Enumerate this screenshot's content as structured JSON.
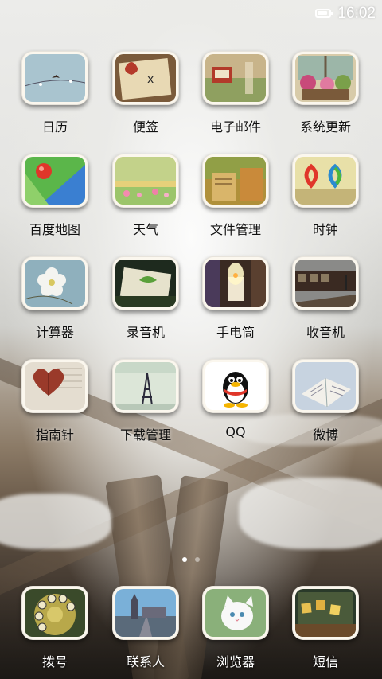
{
  "status_bar": {
    "time": "16:02",
    "battery_level": 0.85
  },
  "apps": [
    {
      "label": "日历",
      "icon": "calendar-icon"
    },
    {
      "label": "便签",
      "icon": "notes-icon"
    },
    {
      "label": "电子邮件",
      "icon": "mail-icon"
    },
    {
      "label": "系统更新",
      "icon": "system-update-icon"
    },
    {
      "label": "百度地图",
      "icon": "baidu-map-icon"
    },
    {
      "label": "天气",
      "icon": "weather-icon"
    },
    {
      "label": "文件管理",
      "icon": "file-manager-icon"
    },
    {
      "label": "时钟",
      "icon": "clock-icon"
    },
    {
      "label": "计算器",
      "icon": "calculator-icon"
    },
    {
      "label": "录音机",
      "icon": "recorder-icon"
    },
    {
      "label": "手电筒",
      "icon": "flashlight-icon"
    },
    {
      "label": "收音机",
      "icon": "radio-icon"
    },
    {
      "label": "指南针",
      "icon": "compass-icon"
    },
    {
      "label": "下载管理",
      "icon": "download-manager-icon"
    },
    {
      "label": "QQ",
      "icon": "qq-icon"
    },
    {
      "label": "微博",
      "icon": "weibo-icon"
    }
  ],
  "dock": [
    {
      "label": "拨号",
      "icon": "dialer-icon"
    },
    {
      "label": "联系人",
      "icon": "contacts-icon"
    },
    {
      "label": "浏览器",
      "icon": "browser-icon"
    },
    {
      "label": "短信",
      "icon": "messages-icon"
    }
  ],
  "page_indicator": {
    "pages": 2,
    "current": 1
  },
  "colors": {
    "label_text": "#111111",
    "dock_label_text": "#ffffff",
    "icon_frame": "#fbf7ee"
  }
}
